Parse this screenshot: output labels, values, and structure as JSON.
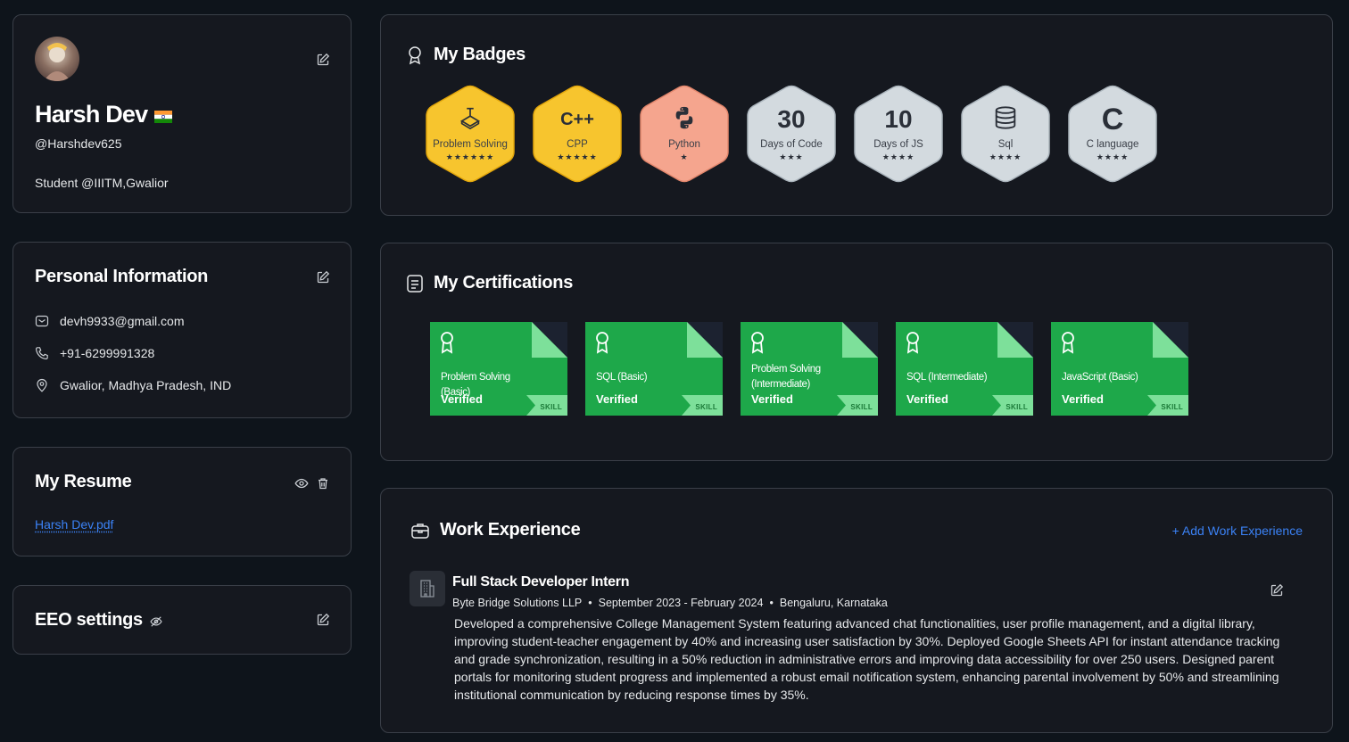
{
  "profile": {
    "name": "Harsh Dev",
    "handle": "@Harshdev625",
    "bio": "Student @IIITM,Gwalior"
  },
  "personal": {
    "title": "Personal Information",
    "email": "devh9933@gmail.com",
    "phone": "+91-6299991328",
    "location": "Gwalior, Madhya Pradesh, IND"
  },
  "resume": {
    "title": "My Resume",
    "file": "Harsh Dev.pdf"
  },
  "eeo": {
    "title": "EEO settings"
  },
  "badges": {
    "title": "My Badges",
    "items": [
      {
        "icon": "cube-icon",
        "label": "Problem Solving",
        "stars": "★★★★★★",
        "color": "gold"
      },
      {
        "icon": "C++",
        "label": "CPP",
        "stars": "★★★★★",
        "color": "gold"
      },
      {
        "icon": "python-icon",
        "label": "Python",
        "stars": "★",
        "color": "salmon"
      },
      {
        "icon": "30",
        "label": "Days of Code",
        "stars": "★★★",
        "color": "silver"
      },
      {
        "icon": "10",
        "label": "Days of JS",
        "stars": "★★★★",
        "color": "silver"
      },
      {
        "icon": "database-icon",
        "label": "Sql",
        "stars": "★★★★",
        "color": "silver"
      },
      {
        "icon": "C",
        "label": "C language",
        "stars": "★★★★",
        "color": "silver"
      }
    ]
  },
  "certifications": {
    "title": "My Certifications",
    "items": [
      {
        "name": "Problem Solving (Basic)",
        "status": "Verified",
        "tag": "SKILL"
      },
      {
        "name": "SQL (Basic)",
        "status": "Verified",
        "tag": "SKILL"
      },
      {
        "name": "Problem Solving (Intermediate)",
        "status": "Verified",
        "tag": "SKILL"
      },
      {
        "name": "SQL (Intermediate)",
        "status": "Verified",
        "tag": "SKILL"
      },
      {
        "name": "JavaScript (Basic)",
        "status": "Verified",
        "tag": "SKILL"
      }
    ]
  },
  "work": {
    "title": "Work Experience",
    "add_label": "+ Add Work Experience",
    "items": [
      {
        "role": "Full Stack Developer Intern",
        "company": "Byte Bridge Solutions LLP",
        "dates": "September 2023 - February 2024",
        "location": "Bengaluru, Karnataka",
        "description": "Developed a comprehensive College Management System featuring advanced chat functionalities, user profile management, and a digital library, improving student-teacher engagement by 40% and increasing user satisfaction by 30%. Deployed Google Sheets API for instant attendance tracking and grade synchronization, resulting in a 50% reduction in administrative errors and improving data accessibility for over 250 users. Designed parent portals for monitoring student progress and implemented a robust email notification system, enhancing parental involvement by 50% and streamlining institutional communication by reducing response times by 35%."
      }
    ]
  },
  "colors": {
    "background": "#0e141b",
    "card": "#15181f",
    "border": "#3a3f48",
    "accent": "#3b82f6",
    "cert_green": "#1ea84a"
  }
}
